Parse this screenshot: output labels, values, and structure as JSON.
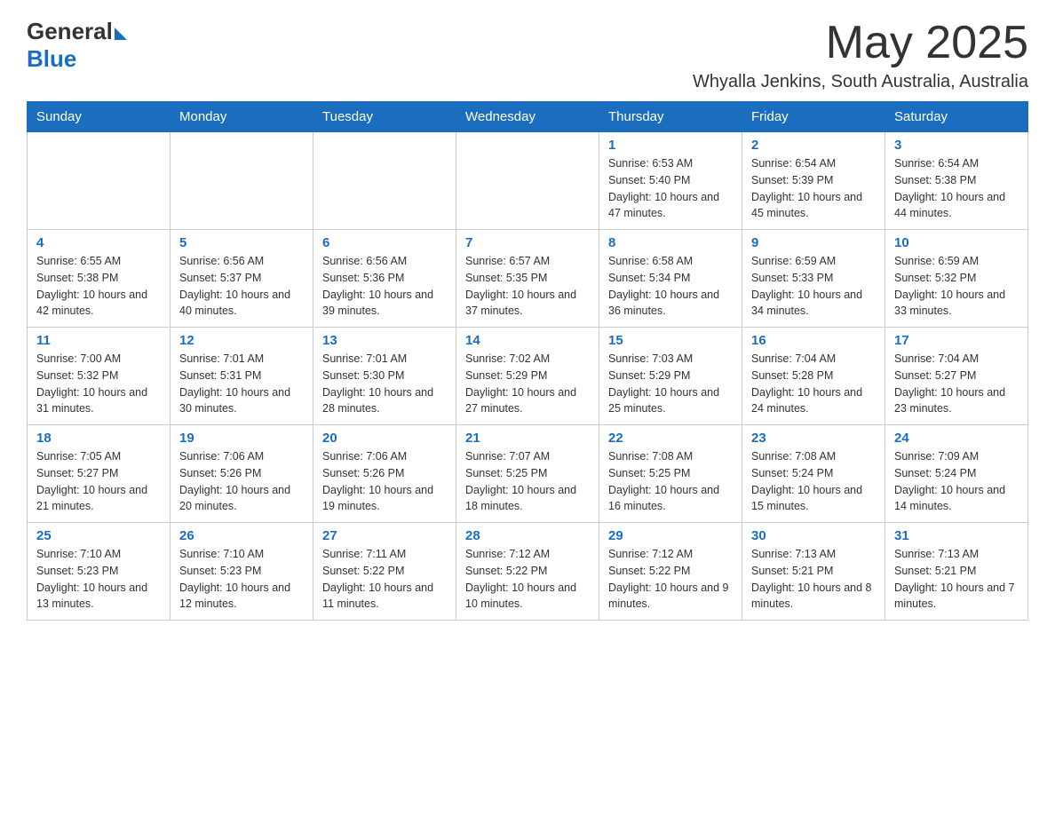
{
  "header": {
    "logo_general": "General",
    "logo_blue": "Blue",
    "month_title": "May 2025",
    "location": "Whyalla Jenkins, South Australia, Australia"
  },
  "weekdays": [
    "Sunday",
    "Monday",
    "Tuesday",
    "Wednesday",
    "Thursday",
    "Friday",
    "Saturday"
  ],
  "weeks": [
    [
      {
        "day": "",
        "sunrise": "",
        "sunset": "",
        "daylight": ""
      },
      {
        "day": "",
        "sunrise": "",
        "sunset": "",
        "daylight": ""
      },
      {
        "day": "",
        "sunrise": "",
        "sunset": "",
        "daylight": ""
      },
      {
        "day": "",
        "sunrise": "",
        "sunset": "",
        "daylight": ""
      },
      {
        "day": "1",
        "sunrise": "Sunrise: 6:53 AM",
        "sunset": "Sunset: 5:40 PM",
        "daylight": "Daylight: 10 hours and 47 minutes."
      },
      {
        "day": "2",
        "sunrise": "Sunrise: 6:54 AM",
        "sunset": "Sunset: 5:39 PM",
        "daylight": "Daylight: 10 hours and 45 minutes."
      },
      {
        "day": "3",
        "sunrise": "Sunrise: 6:54 AM",
        "sunset": "Sunset: 5:38 PM",
        "daylight": "Daylight: 10 hours and 44 minutes."
      }
    ],
    [
      {
        "day": "4",
        "sunrise": "Sunrise: 6:55 AM",
        "sunset": "Sunset: 5:38 PM",
        "daylight": "Daylight: 10 hours and 42 minutes."
      },
      {
        "day": "5",
        "sunrise": "Sunrise: 6:56 AM",
        "sunset": "Sunset: 5:37 PM",
        "daylight": "Daylight: 10 hours and 40 minutes."
      },
      {
        "day": "6",
        "sunrise": "Sunrise: 6:56 AM",
        "sunset": "Sunset: 5:36 PM",
        "daylight": "Daylight: 10 hours and 39 minutes."
      },
      {
        "day": "7",
        "sunrise": "Sunrise: 6:57 AM",
        "sunset": "Sunset: 5:35 PM",
        "daylight": "Daylight: 10 hours and 37 minutes."
      },
      {
        "day": "8",
        "sunrise": "Sunrise: 6:58 AM",
        "sunset": "Sunset: 5:34 PM",
        "daylight": "Daylight: 10 hours and 36 minutes."
      },
      {
        "day": "9",
        "sunrise": "Sunrise: 6:59 AM",
        "sunset": "Sunset: 5:33 PM",
        "daylight": "Daylight: 10 hours and 34 minutes."
      },
      {
        "day": "10",
        "sunrise": "Sunrise: 6:59 AM",
        "sunset": "Sunset: 5:32 PM",
        "daylight": "Daylight: 10 hours and 33 minutes."
      }
    ],
    [
      {
        "day": "11",
        "sunrise": "Sunrise: 7:00 AM",
        "sunset": "Sunset: 5:32 PM",
        "daylight": "Daylight: 10 hours and 31 minutes."
      },
      {
        "day": "12",
        "sunrise": "Sunrise: 7:01 AM",
        "sunset": "Sunset: 5:31 PM",
        "daylight": "Daylight: 10 hours and 30 minutes."
      },
      {
        "day": "13",
        "sunrise": "Sunrise: 7:01 AM",
        "sunset": "Sunset: 5:30 PM",
        "daylight": "Daylight: 10 hours and 28 minutes."
      },
      {
        "day": "14",
        "sunrise": "Sunrise: 7:02 AM",
        "sunset": "Sunset: 5:29 PM",
        "daylight": "Daylight: 10 hours and 27 minutes."
      },
      {
        "day": "15",
        "sunrise": "Sunrise: 7:03 AM",
        "sunset": "Sunset: 5:29 PM",
        "daylight": "Daylight: 10 hours and 25 minutes."
      },
      {
        "day": "16",
        "sunrise": "Sunrise: 7:04 AM",
        "sunset": "Sunset: 5:28 PM",
        "daylight": "Daylight: 10 hours and 24 minutes."
      },
      {
        "day": "17",
        "sunrise": "Sunrise: 7:04 AM",
        "sunset": "Sunset: 5:27 PM",
        "daylight": "Daylight: 10 hours and 23 minutes."
      }
    ],
    [
      {
        "day": "18",
        "sunrise": "Sunrise: 7:05 AM",
        "sunset": "Sunset: 5:27 PM",
        "daylight": "Daylight: 10 hours and 21 minutes."
      },
      {
        "day": "19",
        "sunrise": "Sunrise: 7:06 AM",
        "sunset": "Sunset: 5:26 PM",
        "daylight": "Daylight: 10 hours and 20 minutes."
      },
      {
        "day": "20",
        "sunrise": "Sunrise: 7:06 AM",
        "sunset": "Sunset: 5:26 PM",
        "daylight": "Daylight: 10 hours and 19 minutes."
      },
      {
        "day": "21",
        "sunrise": "Sunrise: 7:07 AM",
        "sunset": "Sunset: 5:25 PM",
        "daylight": "Daylight: 10 hours and 18 minutes."
      },
      {
        "day": "22",
        "sunrise": "Sunrise: 7:08 AM",
        "sunset": "Sunset: 5:25 PM",
        "daylight": "Daylight: 10 hours and 16 minutes."
      },
      {
        "day": "23",
        "sunrise": "Sunrise: 7:08 AM",
        "sunset": "Sunset: 5:24 PM",
        "daylight": "Daylight: 10 hours and 15 minutes."
      },
      {
        "day": "24",
        "sunrise": "Sunrise: 7:09 AM",
        "sunset": "Sunset: 5:24 PM",
        "daylight": "Daylight: 10 hours and 14 minutes."
      }
    ],
    [
      {
        "day": "25",
        "sunrise": "Sunrise: 7:10 AM",
        "sunset": "Sunset: 5:23 PM",
        "daylight": "Daylight: 10 hours and 13 minutes."
      },
      {
        "day": "26",
        "sunrise": "Sunrise: 7:10 AM",
        "sunset": "Sunset: 5:23 PM",
        "daylight": "Daylight: 10 hours and 12 minutes."
      },
      {
        "day": "27",
        "sunrise": "Sunrise: 7:11 AM",
        "sunset": "Sunset: 5:22 PM",
        "daylight": "Daylight: 10 hours and 11 minutes."
      },
      {
        "day": "28",
        "sunrise": "Sunrise: 7:12 AM",
        "sunset": "Sunset: 5:22 PM",
        "daylight": "Daylight: 10 hours and 10 minutes."
      },
      {
        "day": "29",
        "sunrise": "Sunrise: 7:12 AM",
        "sunset": "Sunset: 5:22 PM",
        "daylight": "Daylight: 10 hours and 9 minutes."
      },
      {
        "day": "30",
        "sunrise": "Sunrise: 7:13 AM",
        "sunset": "Sunset: 5:21 PM",
        "daylight": "Daylight: 10 hours and 8 minutes."
      },
      {
        "day": "31",
        "sunrise": "Sunrise: 7:13 AM",
        "sunset": "Sunset: 5:21 PM",
        "daylight": "Daylight: 10 hours and 7 minutes."
      }
    ]
  ]
}
